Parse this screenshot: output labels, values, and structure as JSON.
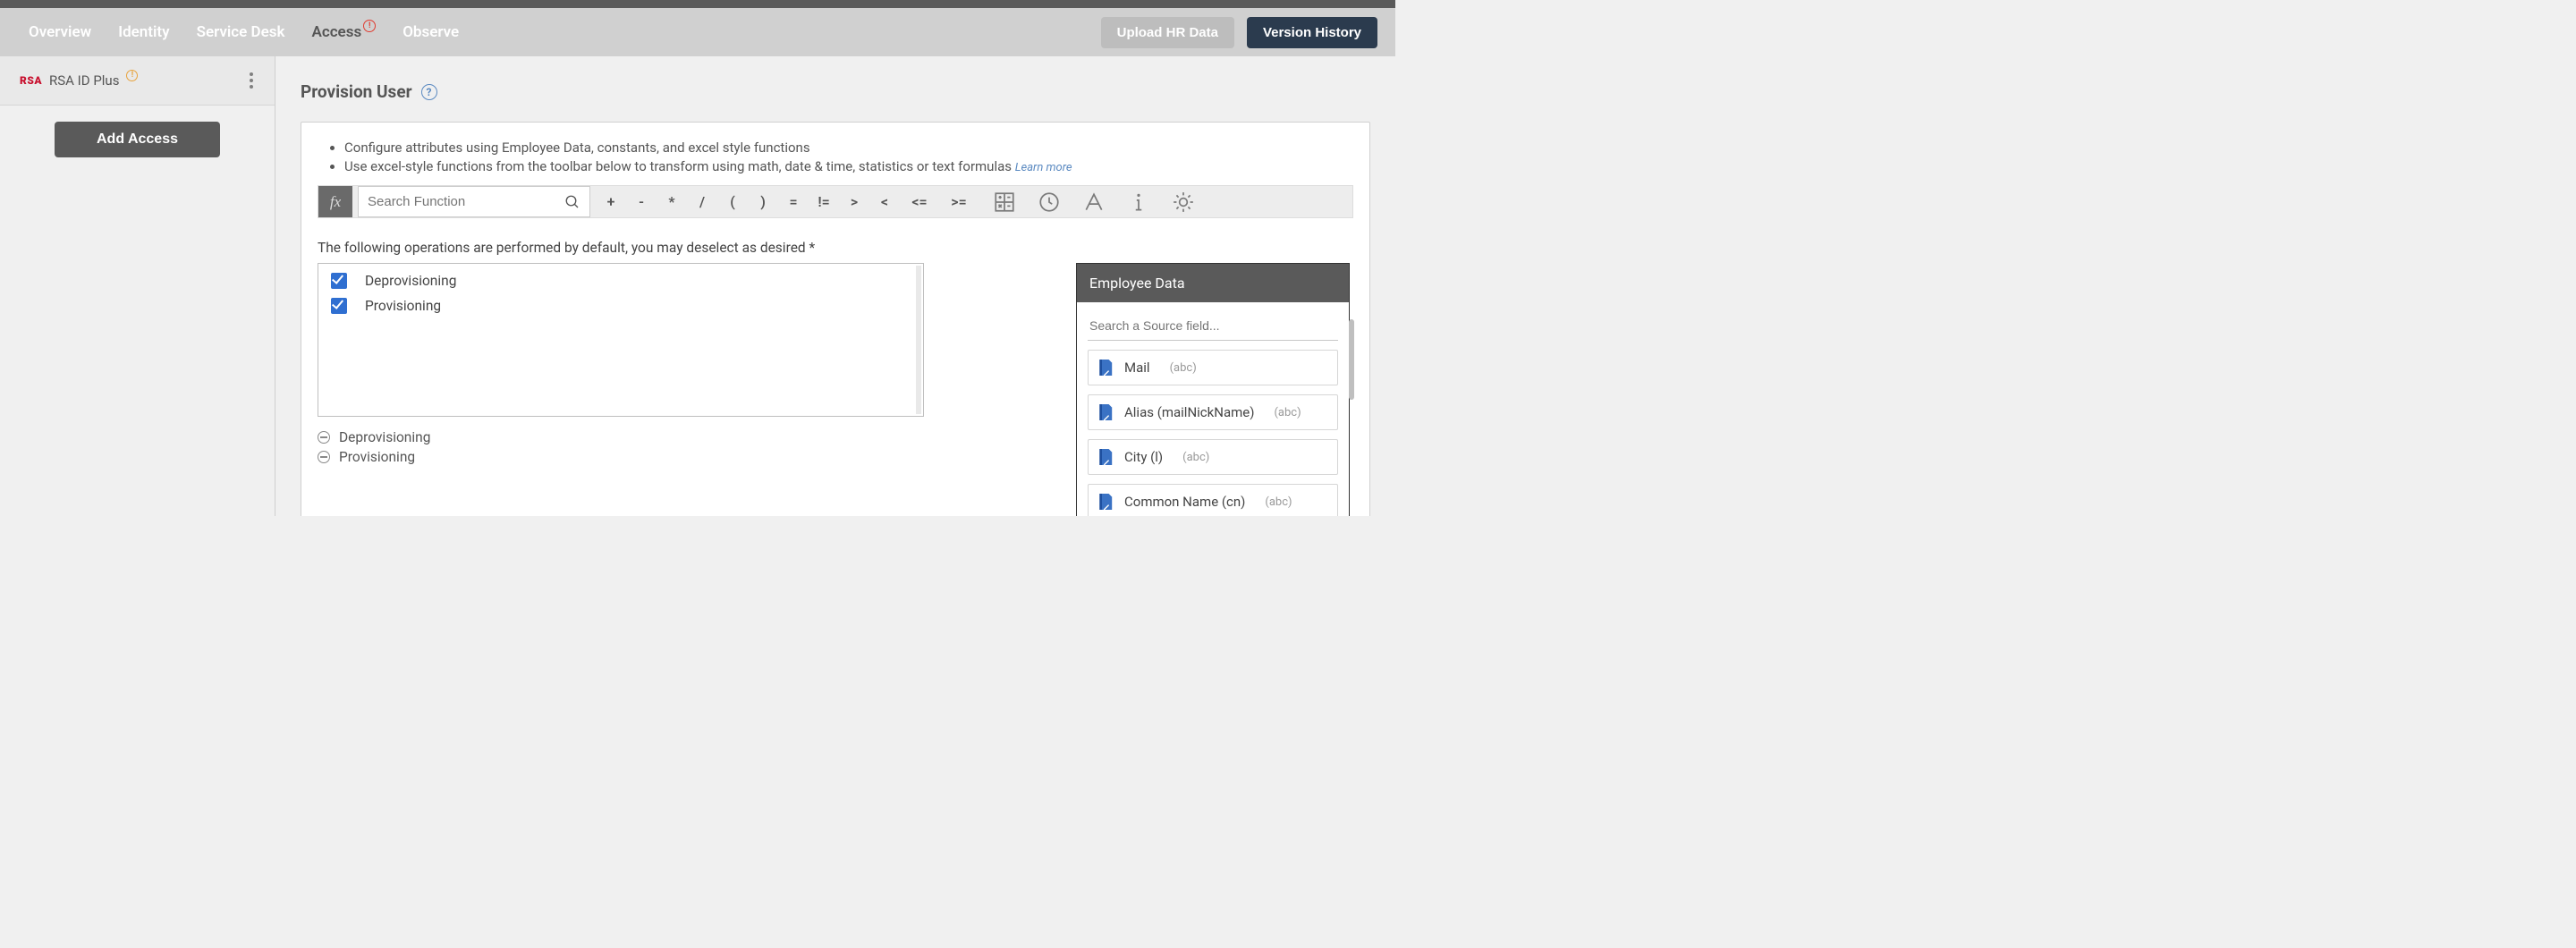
{
  "tabs": {
    "overview": "Overview",
    "identity": "Identity",
    "service_desk": "Service Desk",
    "access": "Access",
    "observe": "Observe"
  },
  "actions": {
    "upload_hr": "Upload HR Data",
    "version_history": "Version History"
  },
  "sidebar": {
    "logo": "RSA",
    "app_name": "RSA ID Plus",
    "add_access": "Add Access"
  },
  "section": {
    "title": "Provision User",
    "bullet1": "Configure attributes using Employee Data, constants, and excel style functions",
    "bullet2": "Use excel-style functions from the toolbar below to transform using math, date & time, statistics or text formulas ",
    "learn_more": "Learn more"
  },
  "formula": {
    "fx": "fx",
    "search_placeholder": "Search Function",
    "ops": [
      "+",
      "-",
      "*",
      "/",
      "(",
      ")",
      "=",
      "!=",
      ">",
      "<",
      "<=",
      ">="
    ]
  },
  "ops_section": {
    "instruction": "The following operations are performed by default, you may deselect as desired *",
    "options": [
      {
        "label": "Deprovisioning",
        "checked": true
      },
      {
        "label": "Provisioning",
        "checked": true
      }
    ],
    "summary": [
      "Deprovisioning",
      "Provisioning"
    ]
  },
  "employee_data": {
    "title": "Employee Data",
    "search_placeholder": "Search a Source field...",
    "fields": [
      {
        "label": "Mail",
        "type": "(abc)"
      },
      {
        "label": "Alias (mailNickName)",
        "type": "(abc)"
      },
      {
        "label": "City (l)",
        "type": "(abc)"
      },
      {
        "label": "Common Name (cn)",
        "type": "(abc)"
      }
    ]
  }
}
